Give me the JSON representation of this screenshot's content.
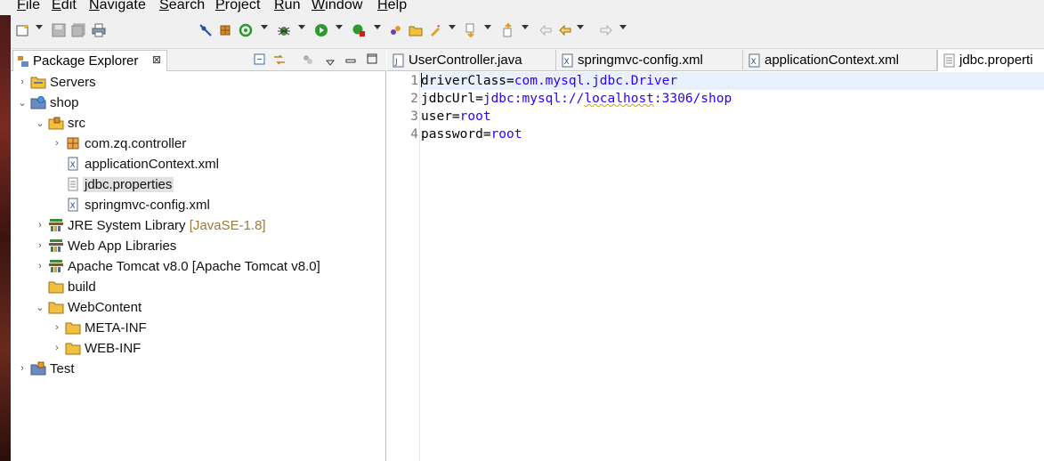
{
  "menubar": {
    "items": [
      {
        "mnemonic": "F",
        "rest": "ile"
      },
      {
        "mnemonic": "E",
        "rest": "dit"
      },
      {
        "mnemonic": "N",
        "rest": "avigate"
      },
      {
        "mnemonic": "S",
        "rest": "earch"
      },
      {
        "mnemonic": "P",
        "rest": "roject"
      },
      {
        "mnemonic": "R",
        "rest": "un"
      },
      {
        "mnemonic": "W",
        "rest": "indow"
      },
      {
        "mnemonic": "H",
        "rest": "elp"
      }
    ]
  },
  "toolbar": {
    "icons": [
      "new-wizard-icon",
      "save-icon",
      "save-all-icon",
      "print-icon",
      "toggle-breakpoint-icon",
      "new-java-project-icon",
      "refresh-icon",
      "debug-icon",
      "run-icon",
      "external-tools-icon",
      "new-package-icon",
      "open-type-icon",
      "next-annotation-icon",
      "previous-annotation-icon",
      "last-edit-location-icon",
      "back-icon",
      "forward-icon"
    ]
  },
  "package_explorer": {
    "title": "Package Explorer",
    "close_glyph": "⊠",
    "tree": [
      {
        "label": "Servers",
        "icon": "folder-icon",
        "expanded": false
      },
      {
        "label": "shop",
        "icon": "web-project-icon",
        "expanded": true
      },
      {
        "label": "src",
        "icon": "source-folder-icon",
        "expanded": true
      },
      {
        "label": "com.zq.controller",
        "icon": "package-icon",
        "expanded": false
      },
      {
        "label": "applicationContext.xml",
        "icon": "xml-file-icon"
      },
      {
        "label": "jdbc.properties",
        "icon": "properties-file-icon",
        "selected": true
      },
      {
        "label": "springmvc-config.xml",
        "icon": "xml-file-icon"
      },
      {
        "label": "JRE System Library",
        "decoration": "[JavaSE-1.8]",
        "icon": "library-icon",
        "expanded": false
      },
      {
        "label": "Web App Libraries",
        "icon": "library-icon",
        "expanded": false
      },
      {
        "label": "Apache Tomcat v8.0 [Apache Tomcat v8.0]",
        "icon": "library-icon",
        "expanded": false
      },
      {
        "label": "build",
        "icon": "folder-icon"
      },
      {
        "label": "WebContent",
        "icon": "folder-icon",
        "expanded": true
      },
      {
        "label": "META-INF",
        "icon": "folder-icon",
        "expanded": false
      },
      {
        "label": "WEB-INF",
        "icon": "folder-icon",
        "expanded": false
      },
      {
        "label": "Test",
        "icon": "java-project-icon",
        "expanded": false
      }
    ]
  },
  "editor": {
    "tabs": [
      {
        "label": "UserController.java",
        "icon": "java-file-icon"
      },
      {
        "label": "springmvc-config.xml",
        "icon": "xml-file-icon"
      },
      {
        "label": "applicationContext.xml",
        "icon": "xml-file-icon"
      },
      {
        "label": "jdbc.properti",
        "icon": "properties-file-icon",
        "active": true
      }
    ],
    "lines": [
      {
        "number": "1",
        "key": "driverClass",
        "eq": "=",
        "value": "com.mysql.jdbc.Driver"
      },
      {
        "number": "2",
        "key": "jdbcUrl",
        "eq": "=",
        "value_pre": "jdbc:mysql://",
        "value_mid": "localhost",
        "value_post": ":3306/shop"
      },
      {
        "number": "3",
        "key": "user",
        "eq": "=",
        "value": "root"
      },
      {
        "number": "4",
        "key": "password",
        "eq": "=",
        "value": "root"
      }
    ]
  }
}
